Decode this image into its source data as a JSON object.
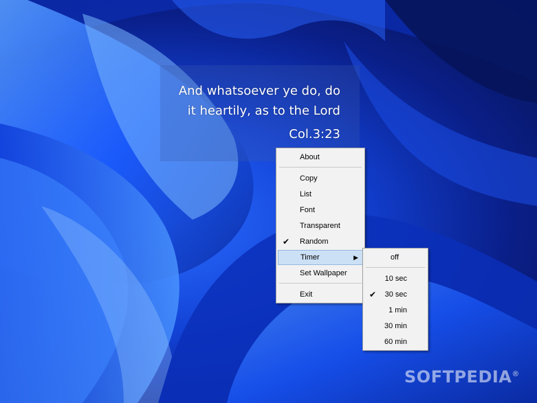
{
  "verse": {
    "line1": "And whatsoever ye do, do",
    "line2": "it heartily, as to the Lord",
    "reference": "Col.3:23"
  },
  "context_menu": {
    "items": {
      "about": "About",
      "copy": "Copy",
      "list": "List",
      "font": "Font",
      "transparent": "Transparent",
      "random": "Random",
      "timer": "Timer",
      "set_wallpaper": "Set Wallpaper",
      "exit": "Exit"
    },
    "random_checked_glyph": "✔",
    "timer_arrow_glyph": "▶"
  },
  "timer_submenu": {
    "items": {
      "off": "off",
      "s10": "10 sec",
      "s30": "30 sec",
      "m1": "1 min",
      "m30": "30 min",
      "m60": "60 min"
    },
    "checked_glyph": "✔"
  },
  "watermark": "SOFTPEDIA",
  "watermark_mark": "®",
  "colors": {
    "menu_bg": "#f2f2f2",
    "menu_highlight": "#cce0f5",
    "wallpaper_accent": "#1a55ff"
  }
}
